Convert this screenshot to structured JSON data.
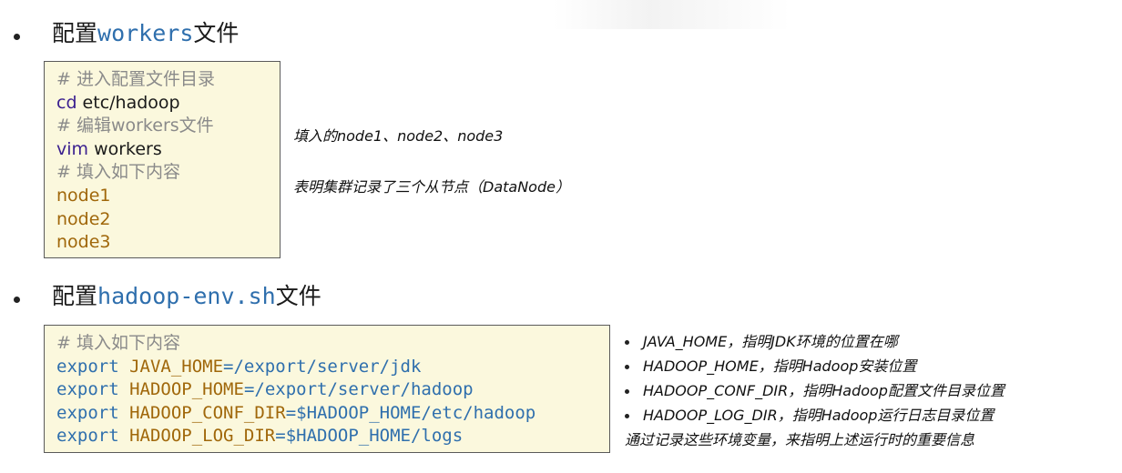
{
  "section1": {
    "heading_prefix": "配置",
    "heading_code": "workers",
    "heading_suffix": "文件",
    "code_lines": [
      "# 进入配置文件目录",
      "cd",
      " etc/hadoop",
      "# 编辑workers文件",
      "vim",
      " workers",
      "# 填入如下内容",
      "node1",
      "node2",
      "node3"
    ],
    "notes": [
      "填入的node1、node2、node3",
      "表明集群记录了三个从节点（DataNode）"
    ]
  },
  "section2": {
    "heading_prefix": "配置",
    "heading_code": "hadoop-env.sh",
    "heading_suffix": "文件",
    "comment": "# 填入如下内容",
    "exports": [
      {
        "kw": "export",
        "name": "JAVA_HOME",
        "value": "=/export/server/jdk"
      },
      {
        "kw": "export",
        "name": "HADOOP_HOME",
        "value": "=/export/server/hadoop"
      },
      {
        "kw": "export",
        "name": "HADOOP_CONF_DIR",
        "value": "=$HADOOP_HOME/etc/hadoop"
      },
      {
        "kw": "export",
        "name": "HADOOP_LOG_DIR",
        "value": "=$HADOOP_HOME/logs"
      }
    ],
    "notes": [
      "JAVA_HOME，指明JDK环境的位置在哪",
      "HADOOP_HOME，指明Hadoop安装位置",
      "HADOOP_CONF_DIR，指明Hadoop配置文件目录位置",
      "HADOOP_LOG_DIR，指明Hadoop运行日志目录位置"
    ],
    "summary": "通过记录这些环境变量，来指明上述运行时的重要信息"
  }
}
